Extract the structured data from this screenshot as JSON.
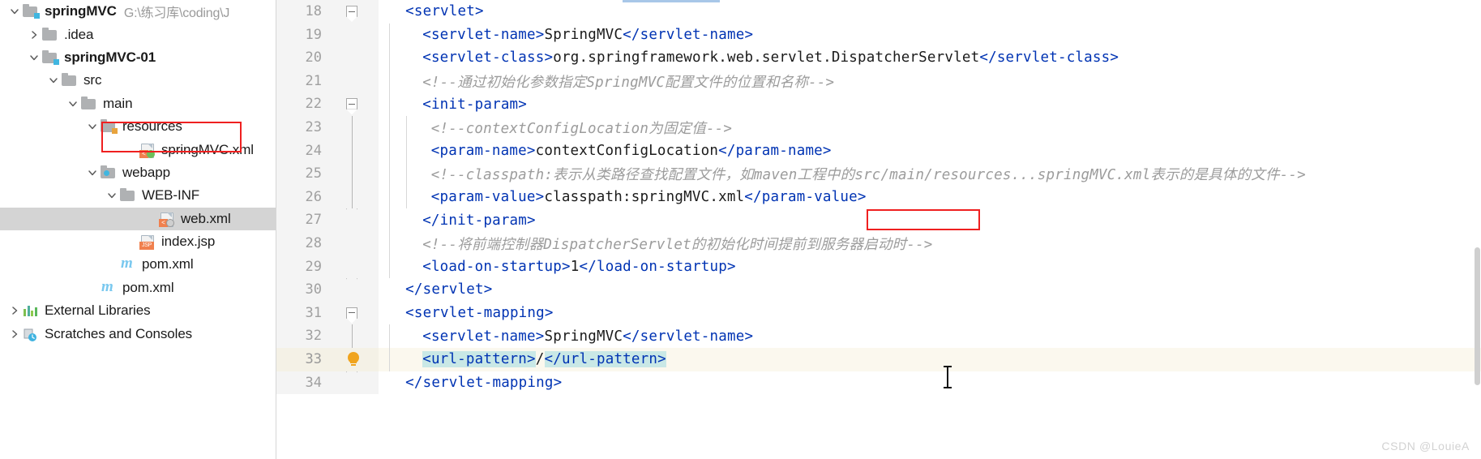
{
  "project_tree": {
    "items": [
      {
        "label": "springMVC",
        "path": "G:\\练习库\\coding\\J",
        "indent": 0,
        "arrow": "down",
        "icon": "module-folder-icon",
        "bold": true,
        "selected": false
      },
      {
        "label": ".idea",
        "path": "",
        "indent": 1,
        "arrow": "right",
        "icon": "folder-icon",
        "bold": false,
        "selected": false
      },
      {
        "label": "springMVC-01",
        "path": "",
        "indent": 1,
        "arrow": "down",
        "icon": "module-folder-icon",
        "bold": true,
        "selected": false
      },
      {
        "label": "src",
        "path": "",
        "indent": 2,
        "arrow": "down",
        "icon": "folder-icon",
        "bold": false,
        "selected": false
      },
      {
        "label": "main",
        "path": "",
        "indent": 3,
        "arrow": "down",
        "icon": "folder-icon",
        "bold": false,
        "selected": false
      },
      {
        "label": "resources",
        "path": "",
        "indent": 4,
        "arrow": "down",
        "icon": "resources-folder-icon",
        "bold": false,
        "selected": false
      },
      {
        "label": "springMVC.xml",
        "path": "",
        "indent": 6,
        "arrow": "none",
        "icon": "spring-xml-file-icon",
        "bold": false,
        "selected": false
      },
      {
        "label": "webapp",
        "path": "",
        "indent": 4,
        "arrow": "down",
        "icon": "webapp-folder-icon",
        "bold": false,
        "selected": false
      },
      {
        "label": "WEB-INF",
        "path": "",
        "indent": 5,
        "arrow": "down",
        "icon": "folder-icon",
        "bold": false,
        "selected": false
      },
      {
        "label": "web.xml",
        "path": "",
        "indent": 7,
        "arrow": "none",
        "icon": "web-xml-file-icon",
        "bold": false,
        "selected": true
      },
      {
        "label": "index.jsp",
        "path": "",
        "indent": 6,
        "arrow": "none",
        "icon": "jsp-file-icon",
        "bold": false,
        "selected": false
      },
      {
        "label": "pom.xml",
        "path": "",
        "indent": 5,
        "arrow": "none",
        "icon": "maven-file-icon",
        "bold": false,
        "selected": false
      },
      {
        "label": "pom.xml",
        "path": "",
        "indent": 4,
        "arrow": "none",
        "icon": "maven-file-icon",
        "bold": false,
        "selected": false
      },
      {
        "label": "External Libraries",
        "path": "",
        "indent": 0,
        "arrow": "right",
        "icon": "libraries-icon",
        "bold": false,
        "selected": false
      },
      {
        "label": "Scratches and Consoles",
        "path": "",
        "indent": 0,
        "arrow": "right",
        "icon": "scratches-icon",
        "bold": false,
        "selected": false
      }
    ]
  },
  "editor": {
    "lines": [
      {
        "num": "18",
        "gutter": "fold-open-top",
        "indent_guides": 0,
        "tokens": [
          {
            "t": "<",
            "c": "tag"
          },
          {
            "t": "servlet",
            "c": "tagn"
          },
          {
            "t": ">",
            "c": "tag"
          }
        ],
        "pad": 2
      },
      {
        "num": "19",
        "gutter": "",
        "indent_guides": 1,
        "tokens": [
          {
            "t": "<",
            "c": "tag"
          },
          {
            "t": "servlet-name",
            "c": "tagn"
          },
          {
            "t": ">",
            "c": "tag"
          },
          {
            "t": "SpringMVC",
            "c": "txt"
          },
          {
            "t": "</",
            "c": "tag"
          },
          {
            "t": "servlet-name",
            "c": "tagn"
          },
          {
            "t": ">",
            "c": "tag"
          }
        ],
        "pad": 4
      },
      {
        "num": "20",
        "gutter": "",
        "indent_guides": 1,
        "tokens": [
          {
            "t": "<",
            "c": "tag"
          },
          {
            "t": "servlet-class",
            "c": "tagn"
          },
          {
            "t": ">",
            "c": "tag"
          },
          {
            "t": "org.springframework.web.servlet.DispatcherServlet",
            "c": "txt"
          },
          {
            "t": "</",
            "c": "tag"
          },
          {
            "t": "servlet-class",
            "c": "tagn"
          },
          {
            "t": ">",
            "c": "tag"
          }
        ],
        "pad": 4
      },
      {
        "num": "21",
        "gutter": "",
        "indent_guides": 1,
        "tokens": [
          {
            "t": "<!--通过初始化参数指定SpringMVC配置文件的位置和名称-->",
            "c": "cmt"
          }
        ],
        "pad": 4
      },
      {
        "num": "22",
        "gutter": "fold-open-top",
        "indent_guides": 1,
        "tokens": [
          {
            "t": "<",
            "c": "tag"
          },
          {
            "t": "init-param",
            "c": "tagn"
          },
          {
            "t": ">",
            "c": "tag"
          }
        ],
        "pad": 4
      },
      {
        "num": "23",
        "gutter": "fold-line",
        "indent_guides": 2,
        "tokens": [
          {
            "t": "<!--contextConfigLocation为固定值-->",
            "c": "cmt"
          }
        ],
        "pad": 5
      },
      {
        "num": "24",
        "gutter": "fold-line",
        "indent_guides": 2,
        "tokens": [
          {
            "t": "<",
            "c": "tag"
          },
          {
            "t": "param-name",
            "c": "tagn"
          },
          {
            "t": ">",
            "c": "tag"
          },
          {
            "t": "contextConfigLocation",
            "c": "txt"
          },
          {
            "t": "</",
            "c": "tag"
          },
          {
            "t": "param-name",
            "c": "tagn"
          },
          {
            "t": ">",
            "c": "tag"
          }
        ],
        "pad": 5
      },
      {
        "num": "25",
        "gutter": "fold-line",
        "indent_guides": 2,
        "tokens": [
          {
            "t": "<!--classpath:表示从类路径查找配置文件，如maven工程中的src/main/resources...springMVC.xml表示的是具体的文件-->",
            "c": "cmt"
          }
        ],
        "pad": 5
      },
      {
        "num": "26",
        "gutter": "fold-line",
        "indent_guides": 2,
        "tokens": [
          {
            "t": "<",
            "c": "tag"
          },
          {
            "t": "param-value",
            "c": "tagn"
          },
          {
            "t": ">",
            "c": "tag"
          },
          {
            "t": "classpath:springMVC.xml",
            "c": "txt"
          },
          {
            "t": "</",
            "c": "tag"
          },
          {
            "t": "param-value",
            "c": "tagn"
          },
          {
            "t": ">",
            "c": "tag"
          }
        ],
        "pad": 5
      },
      {
        "num": "27",
        "gutter": "fold-close-bottom",
        "indent_guides": 1,
        "tokens": [
          {
            "t": "</",
            "c": "tag"
          },
          {
            "t": "init-param",
            "c": "tagn"
          },
          {
            "t": ">",
            "c": "tag"
          }
        ],
        "pad": 4
      },
      {
        "num": "28",
        "gutter": "",
        "indent_guides": 1,
        "tokens": [
          {
            "t": "<!--将前端控制器DispatcherServlet的初始化时间提前到服务器启动时-->",
            "c": "cmt"
          }
        ],
        "pad": 4
      },
      {
        "num": "29",
        "gutter": "",
        "indent_guides": 1,
        "tokens": [
          {
            "t": "<",
            "c": "tag"
          },
          {
            "t": "load-on-startup",
            "c": "tagn"
          },
          {
            "t": ">",
            "c": "tag"
          },
          {
            "t": "1",
            "c": "txt"
          },
          {
            "t": "</",
            "c": "tag"
          },
          {
            "t": "load-on-startup",
            "c": "tagn"
          },
          {
            "t": ">",
            "c": "tag"
          }
        ],
        "pad": 4
      },
      {
        "num": "30",
        "gutter": "fold-close-bottom",
        "indent_guides": 0,
        "tokens": [
          {
            "t": "</",
            "c": "tag"
          },
          {
            "t": "servlet",
            "c": "tagn"
          },
          {
            "t": ">",
            "c": "tag"
          }
        ],
        "pad": 2
      },
      {
        "num": "31",
        "gutter": "fold-open-top",
        "indent_guides": 0,
        "tokens": [
          {
            "t": "<",
            "c": "tag"
          },
          {
            "t": "servlet-mapping",
            "c": "tagn"
          },
          {
            "t": ">",
            "c": "tag"
          }
        ],
        "pad": 2
      },
      {
        "num": "32",
        "gutter": "fold-line",
        "indent_guides": 1,
        "tokens": [
          {
            "t": "<",
            "c": "tag"
          },
          {
            "t": "servlet-name",
            "c": "tagn"
          },
          {
            "t": ">",
            "c": "tag"
          },
          {
            "t": "SpringMVC",
            "c": "txt"
          },
          {
            "t": "</",
            "c": "tag"
          },
          {
            "t": "servlet-name",
            "c": "tagn"
          },
          {
            "t": ">",
            "c": "tag"
          }
        ],
        "pad": 4
      },
      {
        "num": "33",
        "gutter": "bulb",
        "indent_guides": 1,
        "highlight": true,
        "tokens": [
          {
            "t": "<",
            "c": "tag selhl"
          },
          {
            "t": "url-pattern",
            "c": "tagn selhl"
          },
          {
            "t": ">",
            "c": "tag selhl"
          },
          {
            "t": "/",
            "c": "txt"
          },
          {
            "t": "</",
            "c": "tag selhl"
          },
          {
            "t": "url-pattern",
            "c": "tagn selhl"
          },
          {
            "t": ">",
            "c": "tag selhl"
          }
        ],
        "pad": 4
      },
      {
        "num": "34",
        "gutter": "fold-close-bottom",
        "indent_guides": 0,
        "tokens": [
          {
            "t": "</",
            "c": "tag"
          },
          {
            "t": "servlet-mapping",
            "c": "tagn"
          },
          {
            "t": ">",
            "c": "tag"
          }
        ],
        "pad": 2
      }
    ]
  },
  "annotations": {
    "redbox_tree_target": "springMVC.xml",
    "redbox_code_target": "springMVC.xml",
    "redbox_color": "#ef2020"
  },
  "watermark": {
    "text": "CSDN @LouieA"
  }
}
